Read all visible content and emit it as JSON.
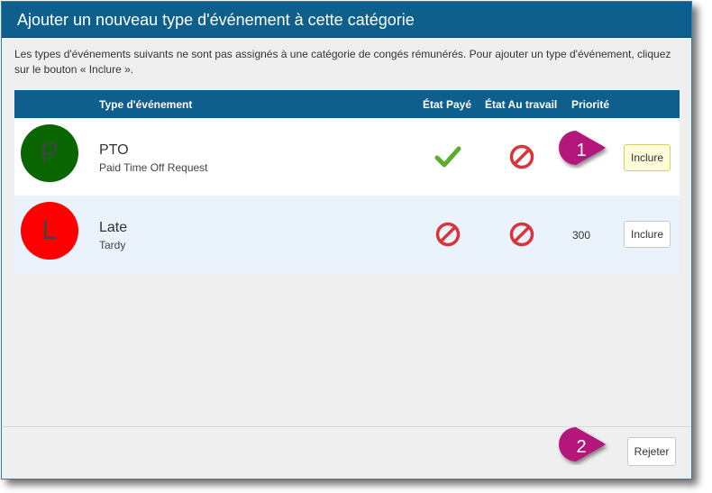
{
  "dialog": {
    "title": "Ajouter un nouveau type d'événement à cette catégorie",
    "description": "Les types d'événements suivants ne sont pas assignés à une catégorie de congés rémunérés. Pour ajouter un type d'événement, cliquez sur le bouton « Inclure »."
  },
  "grid": {
    "columns": {
      "event_type": "Type d'événement",
      "paid_status": "État Payé",
      "work_status": "État Au travail",
      "priority": "Priorité"
    },
    "rows": [
      {
        "initial": "P",
        "name": "PTO",
        "subtitle": "Paid Time Off Request",
        "paid_icon": "check-icon",
        "work_icon": "prohibited-icon",
        "priority": "",
        "action": "Inclure",
        "avatar_color": "#0a6600"
      },
      {
        "initial": "L",
        "name": "Late",
        "subtitle": "Tardy",
        "paid_icon": "prohibited-icon",
        "work_icon": "prohibited-icon",
        "priority": "300",
        "action": "Inclure",
        "avatar_color": "#ff0000"
      }
    ]
  },
  "footer": {
    "reject_label": "Rejeter"
  },
  "callouts": [
    "1",
    "2"
  ],
  "colors": {
    "header": "#0f5f8c",
    "callout": "#b5177c",
    "check": "#5aae2b",
    "prohibited": "#d9343b"
  }
}
